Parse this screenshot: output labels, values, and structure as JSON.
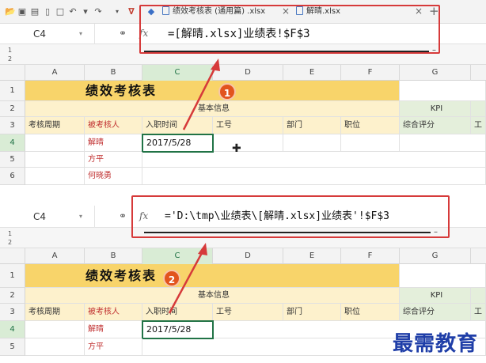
{
  "tabbar": {
    "tab1_label": "绩效考核表 (通用篇) .xlsx",
    "tab2_label": "解晴.xlsx",
    "close": "×",
    "new_tab": "+"
  },
  "panel1": {
    "cell_ref": "C4",
    "fx": "fx",
    "formula": "=[解晴.xlsx]业绩表!$F$3",
    "badge": "1"
  },
  "panel2": {
    "cell_ref": "C4",
    "fx": "fx",
    "formula": "='D:\\tmp\\业绩表\\[解晴.xlsx]业绩表'!$F$3",
    "badge": "2"
  },
  "outline_levels": [
    "1",
    "2"
  ],
  "columns": [
    "A",
    "B",
    "C",
    "D",
    "E",
    "F",
    "G"
  ],
  "sheet": {
    "title": "绩效考核表",
    "section_basic": "基本信息",
    "section_kpi": "KPI",
    "headers": [
      "考核周期",
      "被考核人",
      "入职时间",
      "工号",
      "部门",
      "职位",
      "综合评分",
      "工"
    ],
    "names": [
      "解晴",
      "方平",
      "何晓勇"
    ],
    "date": "2017/5/28"
  },
  "rows1": [
    "1",
    "2",
    "3",
    "4",
    "5",
    "6"
  ],
  "rows2": [
    "1",
    "2",
    "3",
    "4",
    "5"
  ],
  "watermark": "最需教育",
  "colors": {
    "accent_green": "#217346",
    "highlight_red": "#d63a3a",
    "header_yellow": "#f8d46a",
    "badge": "#e2541d"
  }
}
